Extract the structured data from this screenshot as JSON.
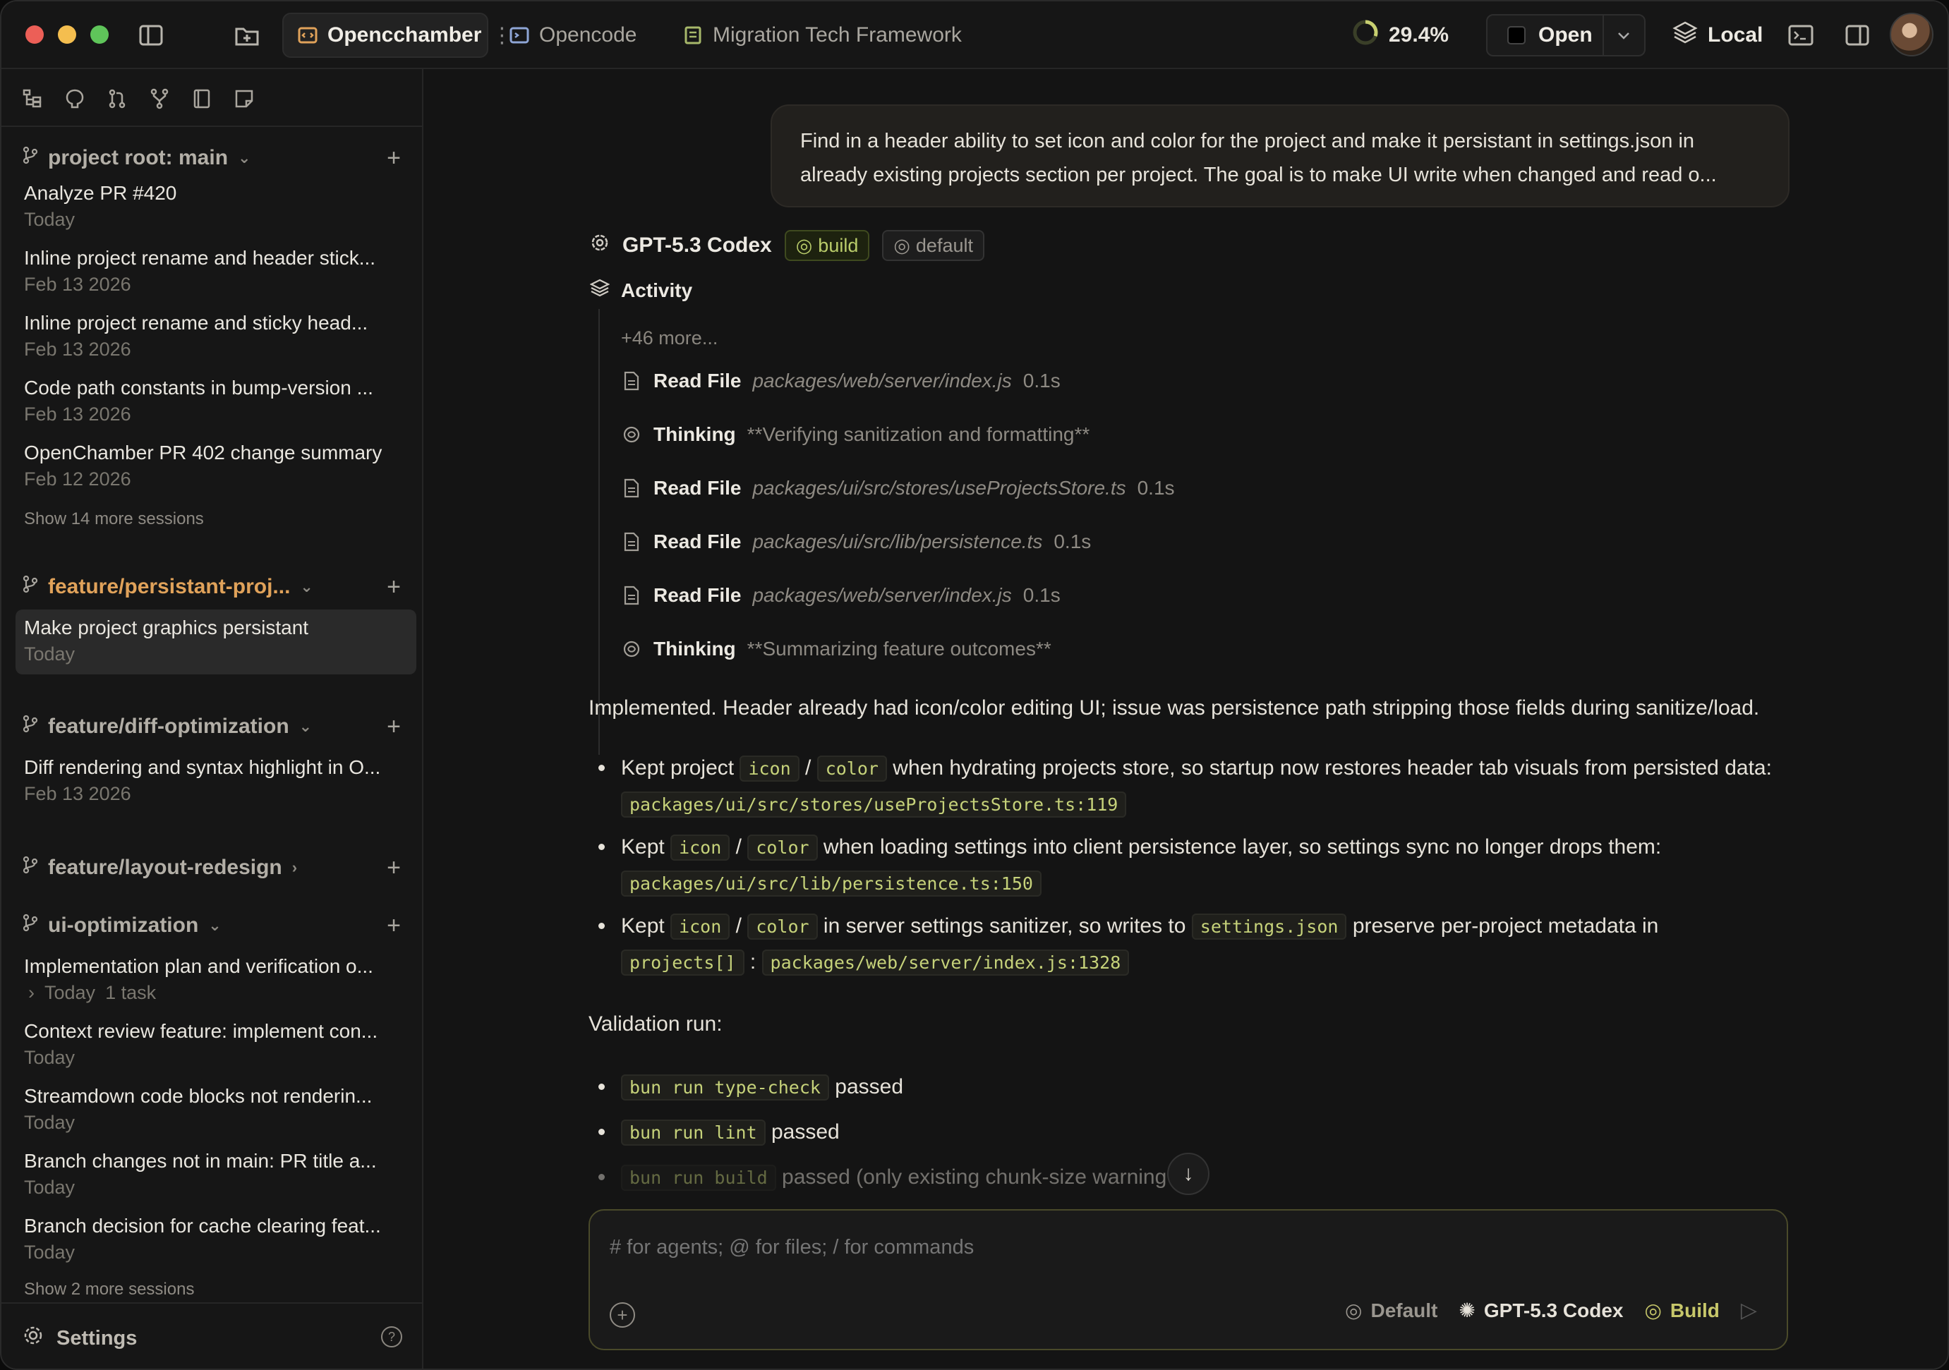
{
  "titlebar": {
    "tabs": [
      {
        "label": "Opencchamber",
        "icon": "code-folder-icon",
        "active": true
      },
      {
        "label": "Opencode",
        "icon": "terminal-icon",
        "active": false
      },
      {
        "label": "Migration Tech Framework",
        "icon": "document-icon",
        "active": false
      }
    ],
    "progress_label": "29.4%",
    "progress_value": 0.294,
    "open_label": "Open",
    "local_label": "Local"
  },
  "sidebar": {
    "groups": [
      {
        "label": "project root: main",
        "sessions": [
          {
            "title": "Analyze PR #420",
            "date": "Today"
          },
          {
            "title": "Inline project rename and header stick...",
            "date": "Feb 13 2026"
          },
          {
            "title": "Inline project rename and sticky head...",
            "date": "Feb 13 2026"
          },
          {
            "title": "Code path constants in bump-version ...",
            "date": "Feb 13 2026"
          },
          {
            "title": "OpenChamber PR 402 change summary",
            "date": "Feb 12 2026"
          }
        ],
        "more": "Show 14 more sessions"
      },
      {
        "label": "feature/persistant-proj...",
        "sessions": [
          {
            "title": "Make project graphics persistant",
            "date": "Today"
          }
        ]
      },
      {
        "label": "feature/diff-optimization",
        "sessions": [
          {
            "title": "Diff rendering and syntax highlight in O...",
            "date": "Feb 13 2026"
          }
        ]
      },
      {
        "label": "feature/layout-redesign",
        "sessions": []
      },
      {
        "label": "ui-optimization",
        "sessions": [
          {
            "title": "Implementation plan and verification o...",
            "date": "Today",
            "task": "1 task"
          },
          {
            "title": "Context review feature: implement con...",
            "date": "Today"
          },
          {
            "title": "Streamdown code blocks not renderin...",
            "date": "Today"
          },
          {
            "title": "Branch changes not in main: PR title a...",
            "date": "Today"
          },
          {
            "title": "Branch decision for cache clearing feat...",
            "date": "Today"
          }
        ],
        "more": "Show 2 more sessions"
      }
    ],
    "settings_label": "Settings",
    "help_glyph": "?"
  },
  "chat": {
    "user_message": "Find in a header ability to set icon and color for the project and make it persistant in settings.json in already existing projects section per project. The goal is to make UI write when changed and read o...",
    "model_name": "GPT-5.3 Codex",
    "agent_badge": "build",
    "variant_badge": "default",
    "activity_label": "Activity",
    "activity_more": "+46 more...",
    "activity": [
      {
        "kind": "Read File",
        "path": "packages/web/server/index.js",
        "duration": "0.1s",
        "icon": "file-icon"
      },
      {
        "kind": "Thinking",
        "path": "**Verifying sanitization and formatting**",
        "duration": "",
        "icon": "brain-icon"
      },
      {
        "kind": "Read File",
        "path": "packages/ui/src/stores/useProjectsStore.ts",
        "duration": "0.1s",
        "icon": "file-icon"
      },
      {
        "kind": "Read File",
        "path": "packages/ui/src/lib/persistence.ts",
        "duration": "0.1s",
        "icon": "file-icon"
      },
      {
        "kind": "Read File",
        "path": "packages/web/server/index.js",
        "duration": "0.1s",
        "icon": "file-icon"
      },
      {
        "kind": "Thinking",
        "path": "**Summarizing feature outcomes**",
        "duration": "",
        "icon": "brain-icon"
      }
    ],
    "summary": "Implemented. Header already had icon/color editing UI; issue was persistence path stripping those fields during sanitize/load.",
    "bullets": {
      "b1_pre": "Kept project",
      "b1_code1": "icon",
      "b1_sep": "/",
      "b1_code2": "color",
      "b1_post": "when hydrating projects store, so startup now restores header tab visuals from persisted data:",
      "b1_path": "packages/ui/src/stores/useProjectsStore.ts:119",
      "b2_pre": "Kept",
      "b2_code1": "icon",
      "b2_sep": "/",
      "b2_code2": "color",
      "b2_post": "when loading settings into client persistence layer, so settings sync no longer drops them:",
      "b2_path": "packages/ui/src/lib/persistence.ts:150",
      "b3_pre": "Kept",
      "b3_code1": "icon",
      "b3_sep": "/",
      "b3_code2": "color",
      "b3_mid": "in server settings sanitizer, so writes to",
      "b3_code3": "settings.json",
      "b3_post": "preserve per-project metadata in",
      "b3_code4": "projects[]",
      "b3_colon": ":",
      "b3_path": "packages/web/server/index.js:1328"
    },
    "validation_label": "Validation run:",
    "validation": [
      {
        "cmd": "bun run type-check",
        "result": "passed"
      },
      {
        "cmd": "bun run lint",
        "result": "passed"
      },
      {
        "cmd": "bun run build",
        "result": "passed (only existing chunk-size warning"
      }
    ]
  },
  "composer": {
    "placeholder": "# for agents; @ for files; / for commands",
    "variant": "Default",
    "model": "GPT-5.3 Codex",
    "agent": "Build"
  },
  "colors": {
    "accent_branch": "#e0a25a",
    "build_green": "#b9cc6a",
    "code_text": "#c6d27a"
  }
}
